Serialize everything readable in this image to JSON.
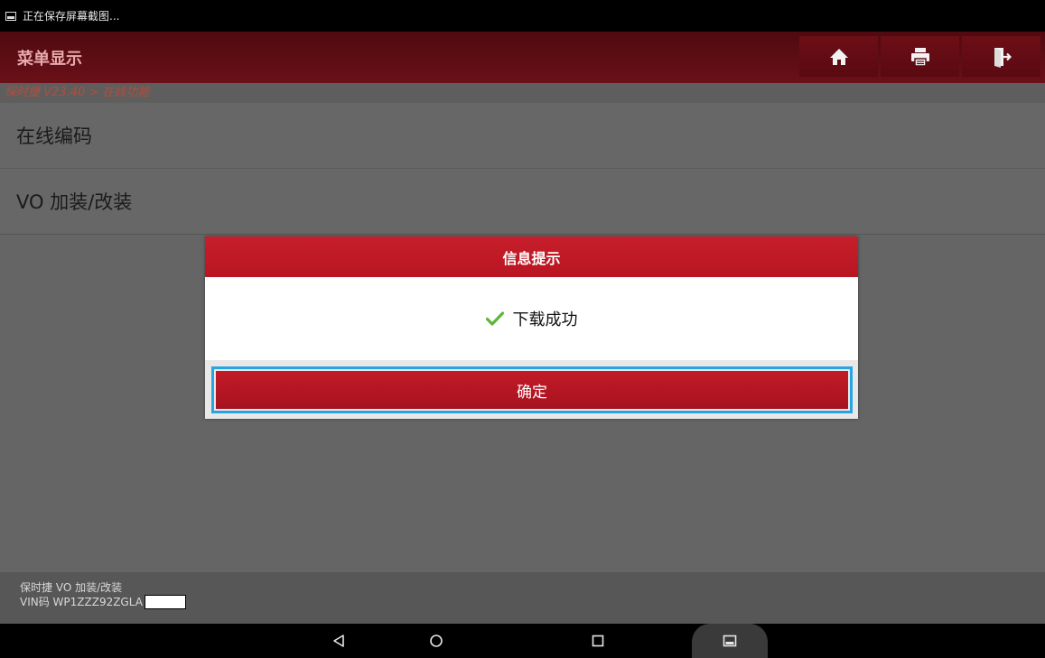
{
  "status_bar": {
    "text": "正在保存屏幕截图..."
  },
  "header": {
    "title": "菜单显示"
  },
  "toolbar": {
    "home_icon": "home-icon",
    "print_icon": "printer-icon",
    "exit_icon": "exit-icon"
  },
  "breadcrumb": "保时捷 V23.40 > 在线功能",
  "menu": {
    "items": [
      {
        "label": "在线编码"
      },
      {
        "label": "VO 加装/改装"
      }
    ]
  },
  "dialog": {
    "title": "信息提示",
    "message": "下载成功",
    "ok_label": "确定"
  },
  "footer": {
    "line1": "保时捷 VO 加装/改装",
    "vin_label": "VIN码 WP1ZZZ92ZGLA"
  },
  "colors": {
    "header_bg": "#5a0b12",
    "accent_red": "#c21a28",
    "focus_blue": "#2aa3e2",
    "check_green": "#5cb833"
  }
}
